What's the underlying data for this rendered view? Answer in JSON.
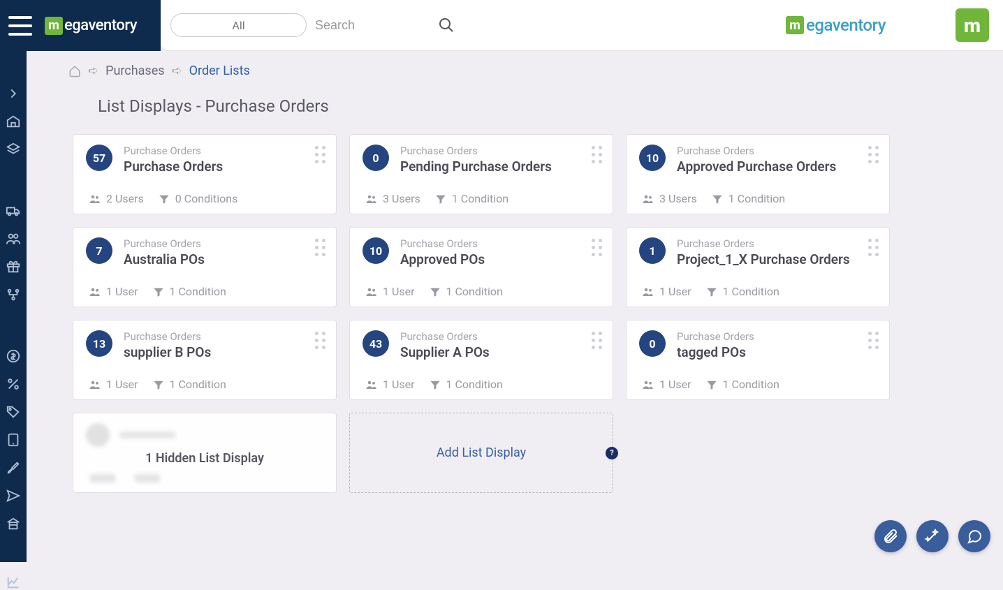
{
  "brand": "egaventory",
  "search": {
    "dropdown": "All",
    "placeholder": "Search"
  },
  "breadcrumb": {
    "level1": "Purchases",
    "level2": "Order Lists"
  },
  "page_title": "List Displays - Purchase Orders",
  "cards": [
    {
      "count": "57",
      "sub": "Purchase Orders",
      "title": "Purchase Orders",
      "users": "2 Users",
      "conditions": "0 Conditions"
    },
    {
      "count": "0",
      "sub": "Purchase Orders",
      "title": "Pending Purchase Orders",
      "users": "3 Users",
      "conditions": "1 Condition"
    },
    {
      "count": "10",
      "sub": "Purchase Orders",
      "title": "Approved Purchase Orders",
      "users": "3 Users",
      "conditions": "1 Condition"
    },
    {
      "count": "7",
      "sub": "Purchase Orders",
      "title": "Australia POs",
      "users": "1 User",
      "conditions": "1 Condition"
    },
    {
      "count": "10",
      "sub": "Purchase Orders",
      "title": "Approved POs",
      "users": "1 User",
      "conditions": "1 Condition"
    },
    {
      "count": "1",
      "sub": "Purchase Orders",
      "title": "Project_1_X Purchase Orders",
      "users": "1 User",
      "conditions": "1 Condition"
    },
    {
      "count": "13",
      "sub": "Purchase Orders",
      "title": "supplier B POs",
      "users": "1 User",
      "conditions": "1 Condition"
    },
    {
      "count": "43",
      "sub": "Purchase Orders",
      "title": "Supplier A POs",
      "users": "1 User",
      "conditions": "1 Condition"
    },
    {
      "count": "0",
      "sub": "Purchase Orders",
      "title": "tagged POs",
      "users": "1 User",
      "conditions": "1 Condition"
    }
  ],
  "hidden_card": "1 Hidden List Display",
  "add_card": "Add List Display",
  "help_symbol": "?"
}
